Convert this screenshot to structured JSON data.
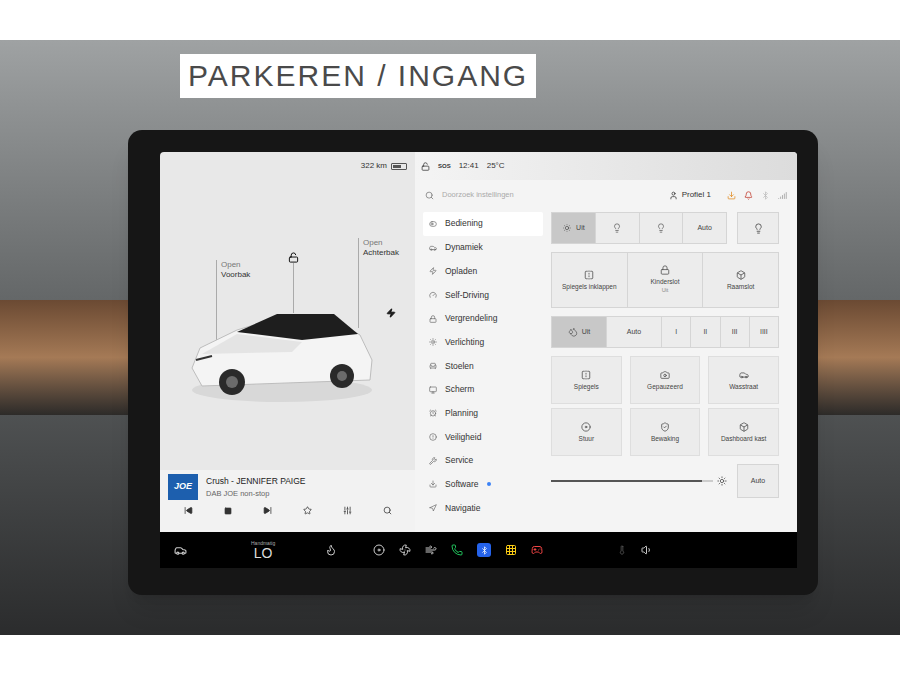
{
  "sign": {
    "text": "PARKEREN / INGANG"
  },
  "left_status": {
    "range": "322 km",
    "battery_level": 0.7
  },
  "car": {
    "frunk": {
      "action": "Open",
      "name": "Voorbak"
    },
    "trunk": {
      "action": "Open",
      "name": "Achterbak"
    },
    "locked": false,
    "charging": true
  },
  "media": {
    "logo": "JOE",
    "title": "Crush - JENNIFER PAIGE",
    "station": "DAB JOE non-stop"
  },
  "top_status": {
    "locked": false,
    "sos": "SOS",
    "time": "12:41",
    "temperature": "25°C"
  },
  "search": {
    "placeholder": "Doorzoek instellingen"
  },
  "profile": {
    "name": "Profiel 1"
  },
  "menu": [
    {
      "label": "Bediening",
      "selected": true,
      "badge": false
    },
    {
      "label": "Dynamiek",
      "selected": false,
      "badge": false
    },
    {
      "label": "Opladen",
      "selected": false,
      "badge": false
    },
    {
      "label": "Self-Driving",
      "selected": false,
      "badge": false
    },
    {
      "label": "Vergrendeling",
      "selected": false,
      "badge": false
    },
    {
      "label": "Verlichting",
      "selected": false,
      "badge": false
    },
    {
      "label": "Stoelen",
      "selected": false,
      "badge": false
    },
    {
      "label": "Scherm",
      "selected": false,
      "badge": false
    },
    {
      "label": "Planning",
      "selected": false,
      "badge": false
    },
    {
      "label": "Veiligheid",
      "selected": false,
      "badge": false
    },
    {
      "label": "Service",
      "selected": false,
      "badge": false
    },
    {
      "label": "Software",
      "selected": false,
      "badge": true
    },
    {
      "label": "Navigatie",
      "selected": false,
      "badge": false
    }
  ],
  "lights": [
    {
      "kind": "icon-text",
      "label": "Uit",
      "selected": true
    },
    {
      "kind": "icon",
      "label": "",
      "selected": false
    },
    {
      "kind": "icon",
      "label": "",
      "selected": false
    },
    {
      "kind": "text",
      "label": "Auto",
      "selected": false
    }
  ],
  "lights_extra": {
    "selected": false
  },
  "quick_buttons": [
    {
      "label": "Spiegels inklappen",
      "sub": ""
    },
    {
      "label": "Kinderslot",
      "sub": "Uit"
    },
    {
      "label": "Raamslot",
      "sub": ""
    }
  ],
  "wipers": [
    {
      "kind": "icon-text",
      "label": "Uit",
      "selected": true
    },
    {
      "kind": "text",
      "label": "Auto",
      "selected": false
    },
    {
      "kind": "text",
      "label": "I",
      "selected": false
    },
    {
      "kind": "text",
      "label": "II",
      "selected": false
    },
    {
      "kind": "text",
      "label": "III",
      "selected": false
    },
    {
      "kind": "text",
      "label": "IIII",
      "selected": false
    }
  ],
  "tiles": [
    {
      "label": "Spiegels"
    },
    {
      "label": "Gepauzeerd"
    },
    {
      "label": "Wasstraat"
    },
    {
      "label": "Stuur"
    },
    {
      "label": "Bewaking"
    },
    {
      "label": "Dashboard kast"
    }
  ],
  "brightness": {
    "level": 0.93,
    "auto": "Auto"
  },
  "bottom_bar": {
    "climate_mode": "Handmatig",
    "temperature": "LO"
  }
}
